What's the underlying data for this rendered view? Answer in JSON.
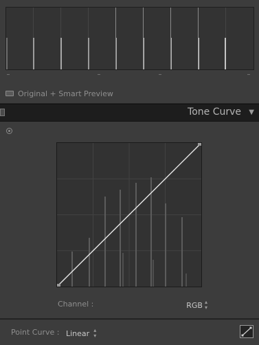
{
  "histogram": {
    "ticks": [
      "–",
      "–",
      "–",
      "–"
    ],
    "preview_label": "Original + Smart Preview"
  },
  "panel": {
    "title": "Tone Curve"
  },
  "channel": {
    "label": "Channel :",
    "value": "RGB"
  },
  "point_curve": {
    "label": "Point Curve :",
    "value": "Linear"
  },
  "icons": {
    "target": "target-adjustment-icon",
    "collapse": "triangle-down-icon",
    "updown": "up-down-arrows-icon",
    "edit_curve": "point-curve-edit-icon",
    "preview": "smart-preview-icon"
  }
}
